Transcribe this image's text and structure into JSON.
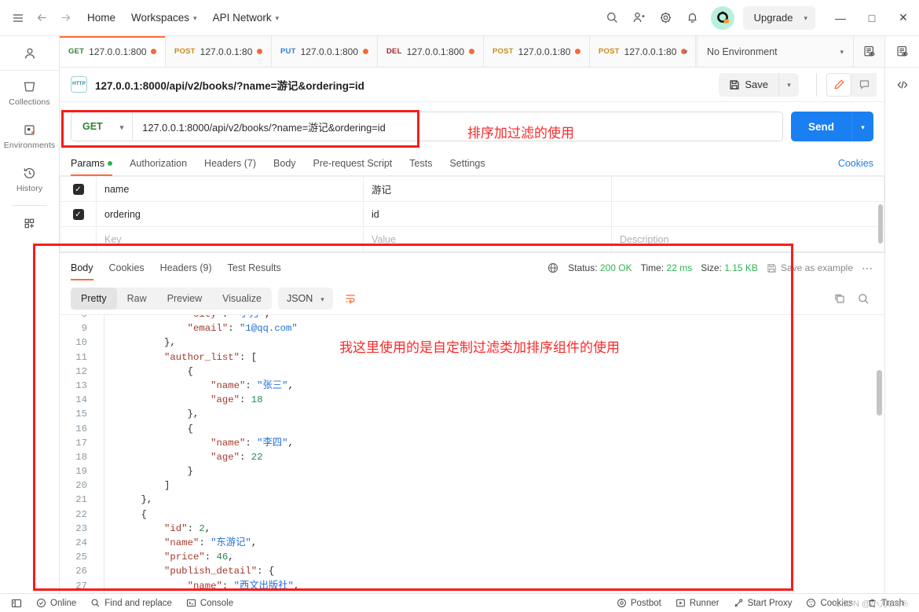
{
  "titlebar": {
    "hamburger_icon": "hamburger-menu-icon",
    "back_icon": "arrow-left-icon",
    "forward_icon": "arrow-right-icon",
    "home": "Home",
    "workspaces": "Workspaces",
    "api_network": "API Network",
    "search_icon": "search-icon",
    "invite_icon": "invite-user-icon",
    "settings_icon": "gear-icon",
    "notifications_icon": "bell-icon",
    "avatar": "user-avatar",
    "upgrade": "Upgrade",
    "minimize": "—",
    "maximize": "□",
    "close": "✕"
  },
  "rail": {
    "user_icon": "person-icon",
    "items": [
      {
        "label": "Collections",
        "icon": "collections-icon"
      },
      {
        "label": "Environments",
        "icon": "environments-icon"
      },
      {
        "label": "History",
        "icon": "history-clock-icon"
      }
    ],
    "new_icon": "new-grid-plus-icon"
  },
  "tabs": {
    "items": [
      {
        "method": "GET",
        "url": "127.0.0.1:800(",
        "dirty": true,
        "active": true
      },
      {
        "method": "POST",
        "url": "127.0.0.1:800(",
        "dirty": true,
        "active": false
      },
      {
        "method": "PUT",
        "url": "127.0.0.1:800(",
        "dirty": true,
        "active": false
      },
      {
        "method": "DEL",
        "url": "127.0.0.1:800(",
        "dirty": true,
        "active": false
      },
      {
        "method": "POST",
        "url": "127.0.0.1:800(",
        "dirty": true,
        "active": false
      },
      {
        "method": "POST",
        "url": "127.0.0.1:800(",
        "dirty": true,
        "active": false
      }
    ],
    "add_label": "+",
    "environment": "No Environment",
    "env_quicklook_icon": "environment-quick-look-icon"
  },
  "request_header": {
    "protocol_badge": "HTTP",
    "title": "127.0.0.1:8000/api/v2/books/?name=游记&ordering=id",
    "save_label": "Save",
    "save_icon": "floppy-disk-icon",
    "edit_icon": "pencil-icon",
    "comment_icon": "comment-icon",
    "code_icon": "code-snippet-icon"
  },
  "url_bar": {
    "method": "GET",
    "url": "127.0.0.1:8000/api/v2/books/?name=游记&ordering=id",
    "send_label": "Send"
  },
  "request_tabs": {
    "items": [
      {
        "label": "Params",
        "badge": "dot",
        "active": true
      },
      {
        "label": "Authorization",
        "badge": "",
        "active": false
      },
      {
        "label": "Headers (7)",
        "badge": "",
        "active": false
      },
      {
        "label": "Body",
        "badge": "",
        "active": false
      },
      {
        "label": "Pre-request Script",
        "badge": "",
        "active": false
      },
      {
        "label": "Tests",
        "badge": "",
        "active": false
      },
      {
        "label": "Settings",
        "badge": "",
        "active": false
      }
    ],
    "cookies_link": "Cookies"
  },
  "params_table": {
    "headers": {
      "key": "Key",
      "value": "Value",
      "description": "Description"
    },
    "rows": [
      {
        "checked": true,
        "key": "name",
        "value": "游记",
        "description": ""
      },
      {
        "checked": true,
        "key": "ordering",
        "value": "id",
        "description": ""
      }
    ],
    "placeholder_row": {
      "key": "Key",
      "value": "Value",
      "description": "Description"
    }
  },
  "response": {
    "tabs": [
      {
        "label": "Body",
        "active": true
      },
      {
        "label": "Cookies",
        "active": false
      },
      {
        "label": "Headers (9)",
        "active": false
      },
      {
        "label": "Test Results",
        "active": false
      }
    ],
    "globe_icon": "globe-icon",
    "status_label": "Status:",
    "status_value": "200 OK",
    "time_label": "Time:",
    "time_value": "22 ms",
    "size_label": "Size:",
    "size_value": "1.15 KB",
    "save_example": "Save as example",
    "save_example_icon": "floppy-disk-icon",
    "more_icon": "more-options-icon",
    "view_modes": [
      {
        "label": "Pretty",
        "active": true
      },
      {
        "label": "Raw",
        "active": false
      },
      {
        "label": "Preview",
        "active": false
      },
      {
        "label": "Visualize",
        "active": false
      }
    ],
    "format": "JSON",
    "wrap_icon": "word-wrap-icon",
    "copy_icon": "copy-icon",
    "search_icon": "search-icon"
  },
  "code": {
    "lines": [
      {
        "n": 8,
        "tokens": [
          {
            "t": "            ",
            "c": "p"
          },
          {
            "t": "\"city\"",
            "c": "k"
          },
          {
            "t": ": ",
            "c": "p"
          },
          {
            "t": "\"小刀\"",
            "c": "s"
          },
          {
            "t": ",",
            "c": "p"
          }
        ]
      },
      {
        "n": 9,
        "tokens": [
          {
            "t": "            ",
            "c": "p"
          },
          {
            "t": "\"email\"",
            "c": "k"
          },
          {
            "t": ": ",
            "c": "p"
          },
          {
            "t": "\"1@qq.com\"",
            "c": "s"
          }
        ]
      },
      {
        "n": 10,
        "tokens": [
          {
            "t": "        },",
            "c": "p"
          }
        ]
      },
      {
        "n": 11,
        "tokens": [
          {
            "t": "        ",
            "c": "p"
          },
          {
            "t": "\"author_list\"",
            "c": "k"
          },
          {
            "t": ": [",
            "c": "p"
          }
        ]
      },
      {
        "n": 12,
        "tokens": [
          {
            "t": "            {",
            "c": "p"
          }
        ]
      },
      {
        "n": 13,
        "tokens": [
          {
            "t": "                ",
            "c": "p"
          },
          {
            "t": "\"name\"",
            "c": "k"
          },
          {
            "t": ": ",
            "c": "p"
          },
          {
            "t": "\"张三\"",
            "c": "s"
          },
          {
            "t": ",",
            "c": "p"
          }
        ]
      },
      {
        "n": 14,
        "tokens": [
          {
            "t": "                ",
            "c": "p"
          },
          {
            "t": "\"age\"",
            "c": "k"
          },
          {
            "t": ": ",
            "c": "p"
          },
          {
            "t": "18",
            "c": "n"
          }
        ]
      },
      {
        "n": 15,
        "tokens": [
          {
            "t": "            },",
            "c": "p"
          }
        ]
      },
      {
        "n": 16,
        "tokens": [
          {
            "t": "            {",
            "c": "p"
          }
        ]
      },
      {
        "n": 17,
        "tokens": [
          {
            "t": "                ",
            "c": "p"
          },
          {
            "t": "\"name\"",
            "c": "k"
          },
          {
            "t": ": ",
            "c": "p"
          },
          {
            "t": "\"李四\"",
            "c": "s"
          },
          {
            "t": ",",
            "c": "p"
          }
        ]
      },
      {
        "n": 18,
        "tokens": [
          {
            "t": "                ",
            "c": "p"
          },
          {
            "t": "\"age\"",
            "c": "k"
          },
          {
            "t": ": ",
            "c": "p"
          },
          {
            "t": "22",
            "c": "n"
          }
        ]
      },
      {
        "n": 19,
        "tokens": [
          {
            "t": "            }",
            "c": "p"
          }
        ]
      },
      {
        "n": 20,
        "tokens": [
          {
            "t": "        ]",
            "c": "p"
          }
        ]
      },
      {
        "n": 21,
        "tokens": [
          {
            "t": "    },",
            "c": "p"
          }
        ]
      },
      {
        "n": 22,
        "tokens": [
          {
            "t": "    {",
            "c": "p"
          }
        ]
      },
      {
        "n": 23,
        "tokens": [
          {
            "t": "        ",
            "c": "p"
          },
          {
            "t": "\"id\"",
            "c": "k"
          },
          {
            "t": ": ",
            "c": "p"
          },
          {
            "t": "2",
            "c": "n"
          },
          {
            "t": ",",
            "c": "p"
          }
        ]
      },
      {
        "n": 24,
        "tokens": [
          {
            "t": "        ",
            "c": "p"
          },
          {
            "t": "\"name\"",
            "c": "k"
          },
          {
            "t": ": ",
            "c": "p"
          },
          {
            "t": "\"东游记\"",
            "c": "s"
          },
          {
            "t": ",",
            "c": "p"
          }
        ]
      },
      {
        "n": 25,
        "tokens": [
          {
            "t": "        ",
            "c": "p"
          },
          {
            "t": "\"price\"",
            "c": "k"
          },
          {
            "t": ": ",
            "c": "p"
          },
          {
            "t": "46",
            "c": "n"
          },
          {
            "t": ",",
            "c": "p"
          }
        ]
      },
      {
        "n": 26,
        "tokens": [
          {
            "t": "        ",
            "c": "p"
          },
          {
            "t": "\"publish_detail\"",
            "c": "k"
          },
          {
            "t": ": {",
            "c": "p"
          }
        ]
      },
      {
        "n": 27,
        "tokens": [
          {
            "t": "            ",
            "c": "p"
          },
          {
            "t": "\"name\"",
            "c": "k"
          },
          {
            "t": ": ",
            "c": "p"
          },
          {
            "t": "\"西文出版社\"",
            "c": "s"
          },
          {
            "t": ",",
            "c": "p"
          }
        ]
      }
    ]
  },
  "statusbar": {
    "left": [
      {
        "label": "",
        "icon": "sidebar-toggle-icon"
      },
      {
        "label": "Online",
        "icon": "online-check-icon"
      },
      {
        "label": "Find and replace",
        "icon": "search-icon"
      },
      {
        "label": "Console",
        "icon": "console-icon"
      }
    ],
    "right": [
      {
        "label": "Postbot",
        "icon": "postbot-icon"
      },
      {
        "label": "Runner",
        "icon": "runner-play-icon"
      },
      {
        "label": "Start Proxy",
        "icon": "proxy-icon"
      },
      {
        "label": "Cookies",
        "icon": "cookie-icon"
      },
      {
        "label": "Trash",
        "icon": "trash-icon"
      }
    ],
    "watermark": "CSDN @小刀che®"
  },
  "annotations": {
    "url_note": "排序加过滤的使用",
    "body_note": "我这里使用的是自定制过滤类加排序组件的使用"
  },
  "colors": {
    "accent": "#ff6c37",
    "send": "#1a7ff0",
    "success": "#2eb553",
    "annotation": "#fb1b1b"
  }
}
